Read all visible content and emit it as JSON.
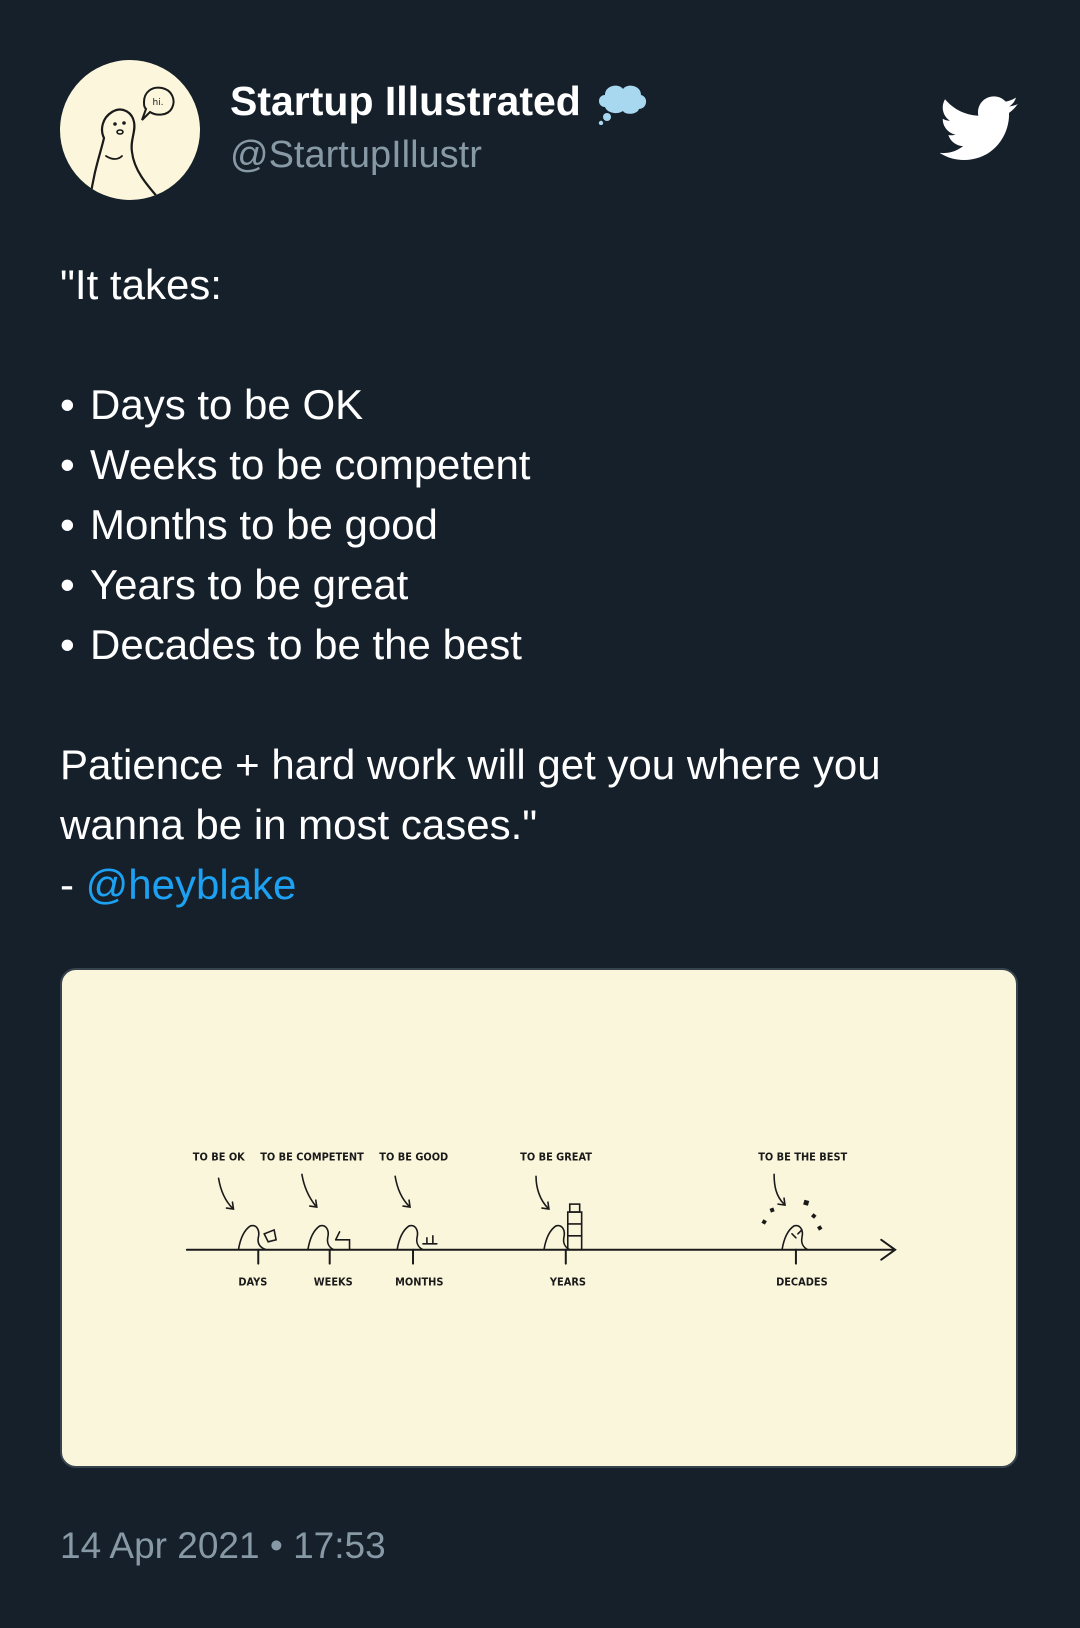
{
  "user": {
    "display_name": "Startup Illustrated",
    "handle": "@StartupIllustr",
    "avatar_icon": "hi-character-avatar",
    "avatar_speech": "hi."
  },
  "tweet": {
    "open_line": "\"It takes:",
    "bullets": [
      "Days to be OK",
      "Weeks to be competent",
      "Months to be good",
      "Years to be great",
      "Decades to be the best"
    ],
    "closing_line_1": "Patience + hard work will get you where you",
    "closing_line_2": "wanna be in most cases.\"",
    "attribution_prefix": "- ",
    "attribution_mention": "@heyblake"
  },
  "illustration": {
    "labels": [
      "TO BE OK",
      "TO BE COMPETENT",
      "TO BE GOOD",
      "TO BE GREAT",
      "TO BE THE BEST"
    ],
    "axis": [
      "DAYS",
      "WEEKS",
      "MONTHS",
      "YEARS",
      "DECADES"
    ]
  },
  "timestamp": "14 Apr 2021 • 17:53",
  "colors": {
    "background": "#15202b",
    "secondary_text": "#8899a6",
    "link": "#1da1f2",
    "illustration_bg": "#faf6dc"
  }
}
